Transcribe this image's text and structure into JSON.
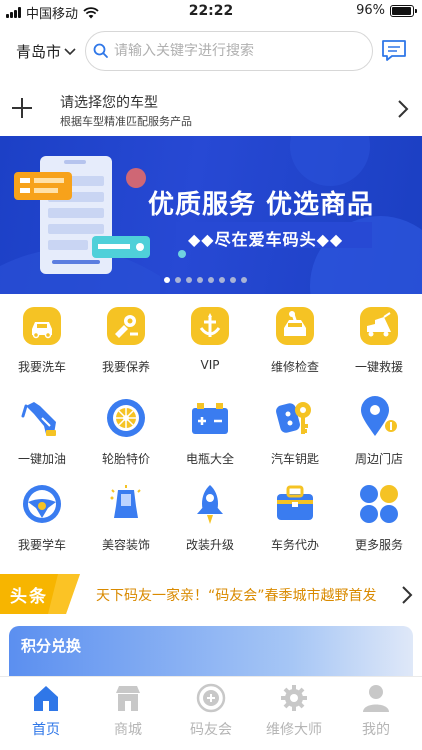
{
  "status_bar": {
    "carrier": "中国移动",
    "time": "22:22",
    "battery": "96%",
    "battery_level": 0.96
  },
  "header": {
    "city": "青岛市",
    "search_placeholder": "请输入关键字进行搜索"
  },
  "car_select": {
    "title": "请选择您的车型",
    "subtitle": "根据车型精准匹配服务产品"
  },
  "banner": {
    "headline": "优质服务  优选商品",
    "tagline": "◆◆尽在爱车码头◆◆",
    "slide_count": 8,
    "active_slide": 1
  },
  "services": [
    {
      "label": "我要洗车",
      "icon": "car-wash-icon"
    },
    {
      "label": "我要保养",
      "icon": "maintenance-icon"
    },
    {
      "label": "VIP",
      "icon": "vip-icon"
    },
    {
      "label": "维修检查",
      "icon": "repair-check-icon"
    },
    {
      "label": "一键救援",
      "icon": "rescue-icon"
    },
    {
      "label": "一键加油",
      "icon": "fuel-nozzle-icon"
    },
    {
      "label": "轮胎特价",
      "icon": "tire-icon"
    },
    {
      "label": "电瓶大全",
      "icon": "battery-icon"
    },
    {
      "label": "汽车钥匙",
      "icon": "car-key-icon"
    },
    {
      "label": "周边门店",
      "icon": "location-pin-icon"
    },
    {
      "label": "我要学车",
      "icon": "steering-wheel-icon"
    },
    {
      "label": "美容装饰",
      "icon": "car-seat-icon"
    },
    {
      "label": "改装升级",
      "icon": "rocket-icon"
    },
    {
      "label": "车务代办",
      "icon": "briefcase-icon"
    },
    {
      "label": "更多服务",
      "icon": "grid-more-icon"
    }
  ],
  "headline": {
    "tag": "头条",
    "text": "天下码友一家亲！“码友会”春季城市越野首发"
  },
  "points": {
    "title": "积分兑换"
  },
  "tabs": [
    {
      "label": "首页",
      "icon": "home-icon",
      "active": true
    },
    {
      "label": "商城",
      "icon": "store-icon",
      "active": false
    },
    {
      "label": "码友会",
      "icon": "club-icon",
      "active": false
    },
    {
      "label": "维修大师",
      "icon": "gear-icon",
      "active": false
    },
    {
      "label": "我的",
      "icon": "profile-icon",
      "active": false
    }
  ],
  "colors": {
    "accent": "#2f77e8",
    "icon_yellow": "#f5c324",
    "icon_blue": "#3a7cf0",
    "headline_orange": "#d98a00",
    "banner_blue": "#1f44ce"
  }
}
